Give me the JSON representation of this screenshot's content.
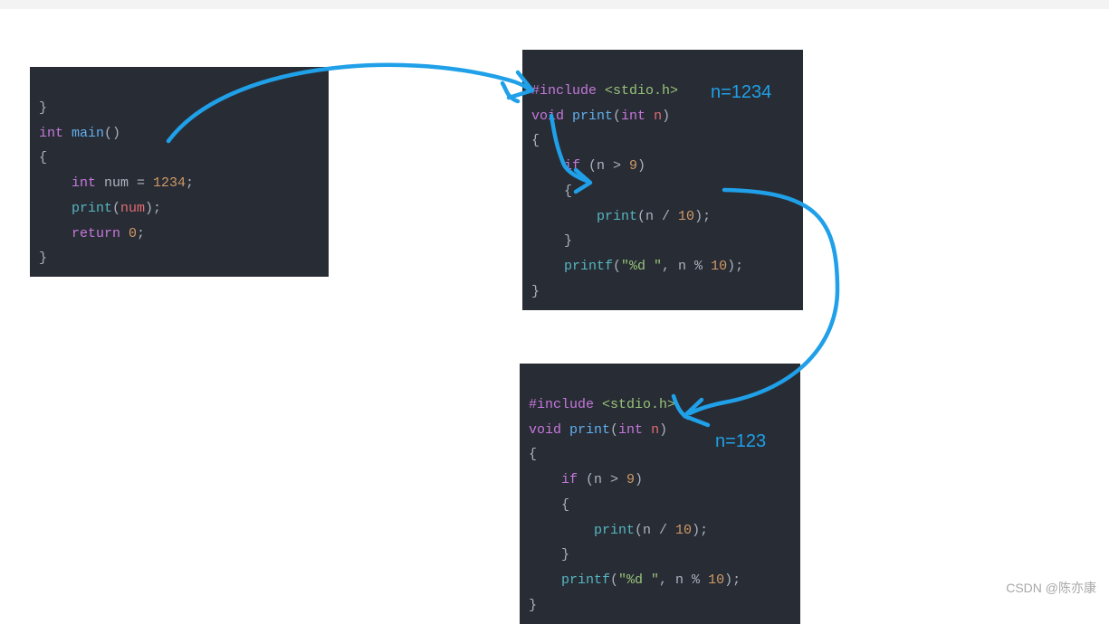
{
  "block1": {
    "l1a": "}",
    "l2a": "int",
    "l2b": " main",
    "l2c": "()",
    "l3a": "{",
    "l4a": "    int",
    "l4b": " num = ",
    "l4c": "1234",
    "l4d": ";",
    "l5a": "    print",
    "l5b": "(",
    "l5c": "num",
    "l5d": ");",
    "l6a": "    return",
    "l6b": " ",
    "l6c": "0",
    "l6d": ";",
    "l7a": "}"
  },
  "block2": {
    "l1a": "#include",
    "l1b": " ",
    "l1c": "<stdio.h>",
    "l2a": "void",
    "l2b": " print",
    "l2c": "(",
    "l2d": "int",
    "l2e": " n",
    "l2f": ")",
    "l3a": "{",
    "l4a": "    if",
    "l4b": " (n > ",
    "l4c": "9",
    "l4d": ")",
    "l5a": "    {",
    "l6a": "        print",
    "l6b": "(n / ",
    "l6c": "10",
    "l6d": ");",
    "l7a": "    }",
    "l8a": "    printf",
    "l8b": "(",
    "l8c": "\"%d \"",
    "l8d": ", n % ",
    "l8e": "10",
    "l8f": ");",
    "l9a": "}"
  },
  "block3": {
    "l1a": "#include",
    "l1b": " ",
    "l1c": "<stdio.h>",
    "l2a": "void",
    "l2b": " print",
    "l2c": "(",
    "l2d": "int",
    "l2e": " n",
    "l2f": ")",
    "l3a": "{",
    "l4a": "    if",
    "l4b": " (n > ",
    "l4c": "9",
    "l4d": ")",
    "l5a": "    {",
    "l6a": "        print",
    "l6b": "(n / ",
    "l6c": "10",
    "l6d": ");",
    "l7a": "    }",
    "l8a": "    printf",
    "l8b": "(",
    "l8c": "\"%d \"",
    "l8d": ", n % ",
    "l8e": "10",
    "l8f": ");",
    "l9a": "}"
  },
  "annot1": "n=1234",
  "annot2": "n=123",
  "watermark": "CSDN @陈亦康"
}
